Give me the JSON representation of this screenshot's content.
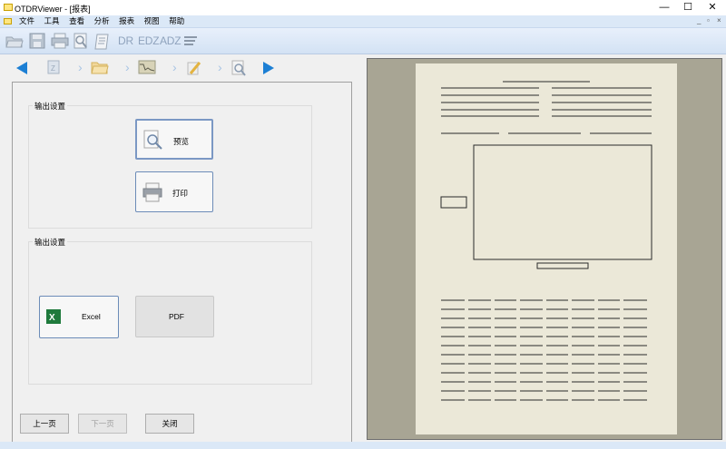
{
  "window": {
    "title": "OTDRViewer - [报表]",
    "minimize": "—",
    "maximize": "☐",
    "close": "✕"
  },
  "menu": {
    "items": [
      "文件",
      "工具",
      "查看",
      "分析",
      "报表",
      "视图",
      "帮助"
    ],
    "mdi_min": "_",
    "mdi_restore": "▫",
    "mdi_close": "×"
  },
  "toolbar": {
    "dr": "DR",
    "edz": "EDZ",
    "adz": "ADZ"
  },
  "output_group_1": {
    "label": "输出设置",
    "preview": "预览",
    "print": "打印"
  },
  "output_group_2": {
    "label": "输出设置",
    "excel": "Excel",
    "pdf": "PDF"
  },
  "nav_buttons": {
    "prev": "上一页",
    "next": "下一页",
    "close": "关闭"
  },
  "colors": {
    "accent": "#1c7fd4",
    "preview_bg": "#a8a594",
    "page_bg": "#ebe8d8"
  }
}
